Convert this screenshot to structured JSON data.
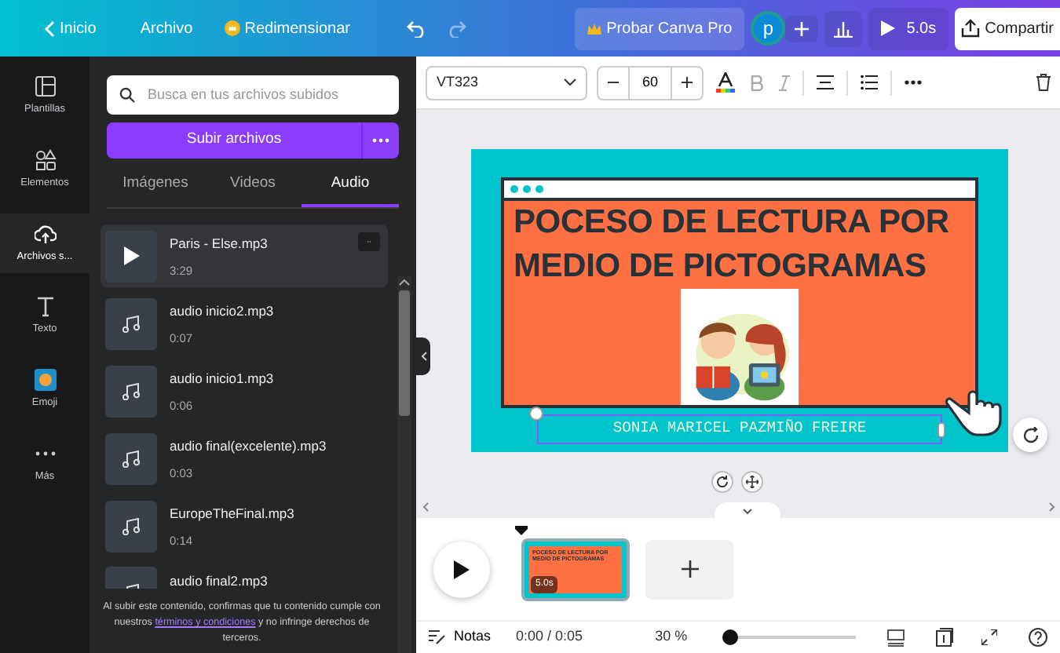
{
  "top_bar": {
    "back": "Inicio",
    "file": "Archivo",
    "resize": "Redimensionar",
    "pro": "Probar Canva Pro",
    "avatar": "p",
    "play_time": "5.0s",
    "share": "Compartir"
  },
  "rail": [
    {
      "kind": "templates",
      "label": "Plantillas",
      "selected": false
    },
    {
      "kind": "elements",
      "label": "Elementos",
      "selected": false
    },
    {
      "kind": "uploads",
      "label": "Archivos s...",
      "selected": true
    },
    {
      "kind": "text",
      "label": "Texto",
      "selected": false
    },
    {
      "kind": "emoji",
      "label": "Emoji",
      "selected": false
    },
    {
      "kind": "more",
      "label": "Más",
      "selected": false
    }
  ],
  "panel": {
    "search": {
      "placeholder": "Busca en tus archivos subidos"
    },
    "upload_button": "Subir archivos",
    "tabs": [
      {
        "label": "Imágenes",
        "selected": false
      },
      {
        "label": "Videos",
        "selected": false
      },
      {
        "label": "Audio",
        "selected": true
      }
    ],
    "files": [
      {
        "name": "Paris - Else.mp3",
        "duration": "3:29",
        "selected": true
      },
      {
        "name": "audio inicio2.mp3",
        "duration": "0:07",
        "selected": false
      },
      {
        "name": "audio inicio1.mp3",
        "duration": "0:06",
        "selected": false
      },
      {
        "name": "audio final(excelente).mp3",
        "duration": "0:03",
        "selected": false
      },
      {
        "name": "EuropeTheFinal.mp3",
        "duration": "0:14",
        "selected": false
      },
      {
        "name": "audio final2.mp3",
        "selected": false
      }
    ],
    "notice": {
      "before": "Al subir este contenido, confirmas que tu contenido cumple con nuestros",
      "link": "términos y condiciones",
      "after": "y no infringe derechos de terceros."
    }
  },
  "toolbar": {
    "font": "VT323",
    "font_size": "60"
  },
  "design": {
    "title_lines": [
      "POCESO DE LECTURA POR",
      "MEDIO DE PICTOGRAMAS"
    ],
    "author": "SONIA MARICEL PAZMIÑO FREIRE"
  },
  "timeline": {
    "thumbnail_title": "POCESO DE LECTURA POR MEDIO DE PICTOGRAMAS",
    "duration": "5.0s"
  },
  "bottom_bar": {
    "notes": "Notas",
    "time": "0:00 / 0:05",
    "zoom": "30 %",
    "zoom_level": {
      "level": 0
    }
  }
}
